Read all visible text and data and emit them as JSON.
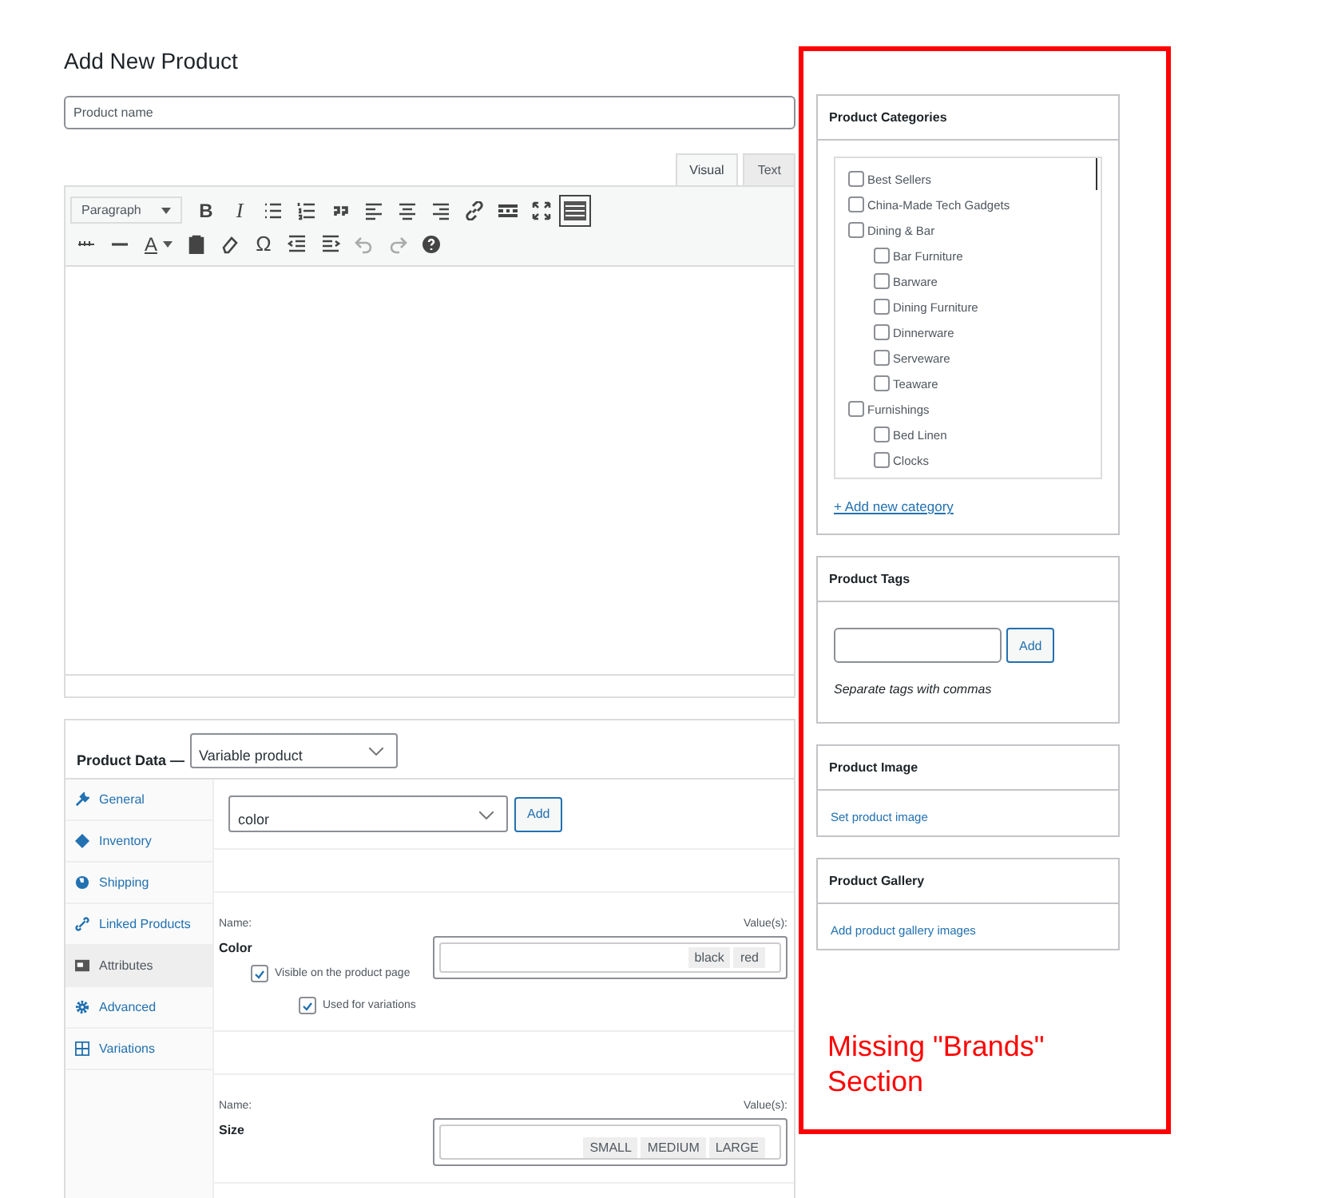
{
  "page_title": "Add New Product",
  "product_name": {
    "placeholder": "Product name"
  },
  "editor": {
    "tabs": [
      {
        "label": "Visual",
        "selected": true
      },
      {
        "label": "Text",
        "selected": false
      }
    ],
    "format": "Paragraph",
    "bold": "B",
    "italic": "I",
    "text_color": "A",
    "special_char": "Ω",
    "toolbar_toggle_on": true
  },
  "product_data": {
    "title": "Product Data —",
    "type": "Variable product",
    "tabs": [
      {
        "label": "General",
        "selected": false
      },
      {
        "label": "Inventory",
        "selected": false
      },
      {
        "label": "Shipping",
        "selected": false
      },
      {
        "label": "Linked Products",
        "selected": false
      },
      {
        "label": "Attributes",
        "selected": true
      },
      {
        "label": "Advanced",
        "selected": false
      },
      {
        "label": "Variations",
        "selected": false
      }
    ],
    "attribute_select": "color",
    "add_button": "Add",
    "attributes": [
      {
        "name_label": "Name:",
        "values_label": "Value(s):",
        "name": "Color",
        "values": [
          "black",
          "red"
        ],
        "visible_label": "Visible on the product page",
        "visible": true,
        "variations_label": "Used for variations",
        "variations": true
      },
      {
        "name_label": "Name:",
        "values_label": "Value(s):",
        "name": "Size",
        "values": [
          "SMALL",
          "MEDIUM",
          "LARGE"
        ]
      }
    ]
  },
  "categories": {
    "title": "Product Categories",
    "items": [
      {
        "label": "Best Sellers",
        "checked": false
      },
      {
        "label": "China-Made Tech Gadgets",
        "checked": false
      },
      {
        "label": "Dining & Bar",
        "checked": false,
        "children": [
          {
            "label": "Bar Furniture",
            "checked": false
          },
          {
            "label": "Barware",
            "checked": false
          },
          {
            "label": "Dining Furniture",
            "checked": false
          },
          {
            "label": "Dinnerware",
            "checked": false
          },
          {
            "label": "Serveware",
            "checked": false
          },
          {
            "label": "Teaware",
            "checked": false
          }
        ]
      },
      {
        "label": "Furnishings",
        "checked": false,
        "children": [
          {
            "label": "Bed Linen",
            "checked": false
          },
          {
            "label": "Clocks",
            "checked": false
          }
        ]
      }
    ],
    "add_link": "+ Add new category"
  },
  "tags": {
    "title": "Product Tags",
    "add_button": "Add",
    "hint": "Separate tags with commas"
  },
  "image": {
    "title": "Product Image",
    "link": "Set product image"
  },
  "gallery": {
    "title": "Product Gallery",
    "link": "Add product gallery images"
  },
  "annotation": "Missing \"Brands\" Section"
}
